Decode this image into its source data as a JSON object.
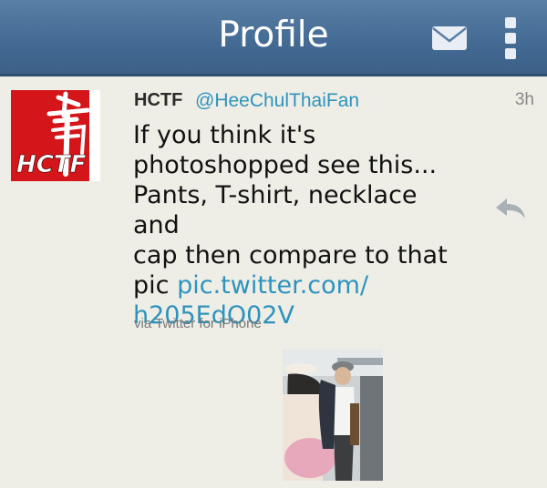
{
  "header": {
    "title": "Profile",
    "mail_icon": "envelope-icon",
    "menu_icon": "overflow-menu-icon"
  },
  "tweet": {
    "avatar_logo_text": "HCTF",
    "author_name": "HCTF",
    "author_handle": "@HeeChulThaiFan",
    "timestamp": "3h",
    "text_lines": [
      "If you think it's",
      "photoshopped see this...",
      "Pants, T-shirt, necklace and",
      "cap then compare to that",
      "pic "
    ],
    "link_part1": "pic.twitter.com/",
    "link_part2": "h205EdO02V",
    "source": "via Twitter for iPhone",
    "reply_icon": "reply-icon",
    "media_icon": "photo-thumbnail"
  },
  "colors": {
    "header_bg": "#436a93",
    "link": "#2d93bd",
    "page_bg": "#efeee6"
  }
}
